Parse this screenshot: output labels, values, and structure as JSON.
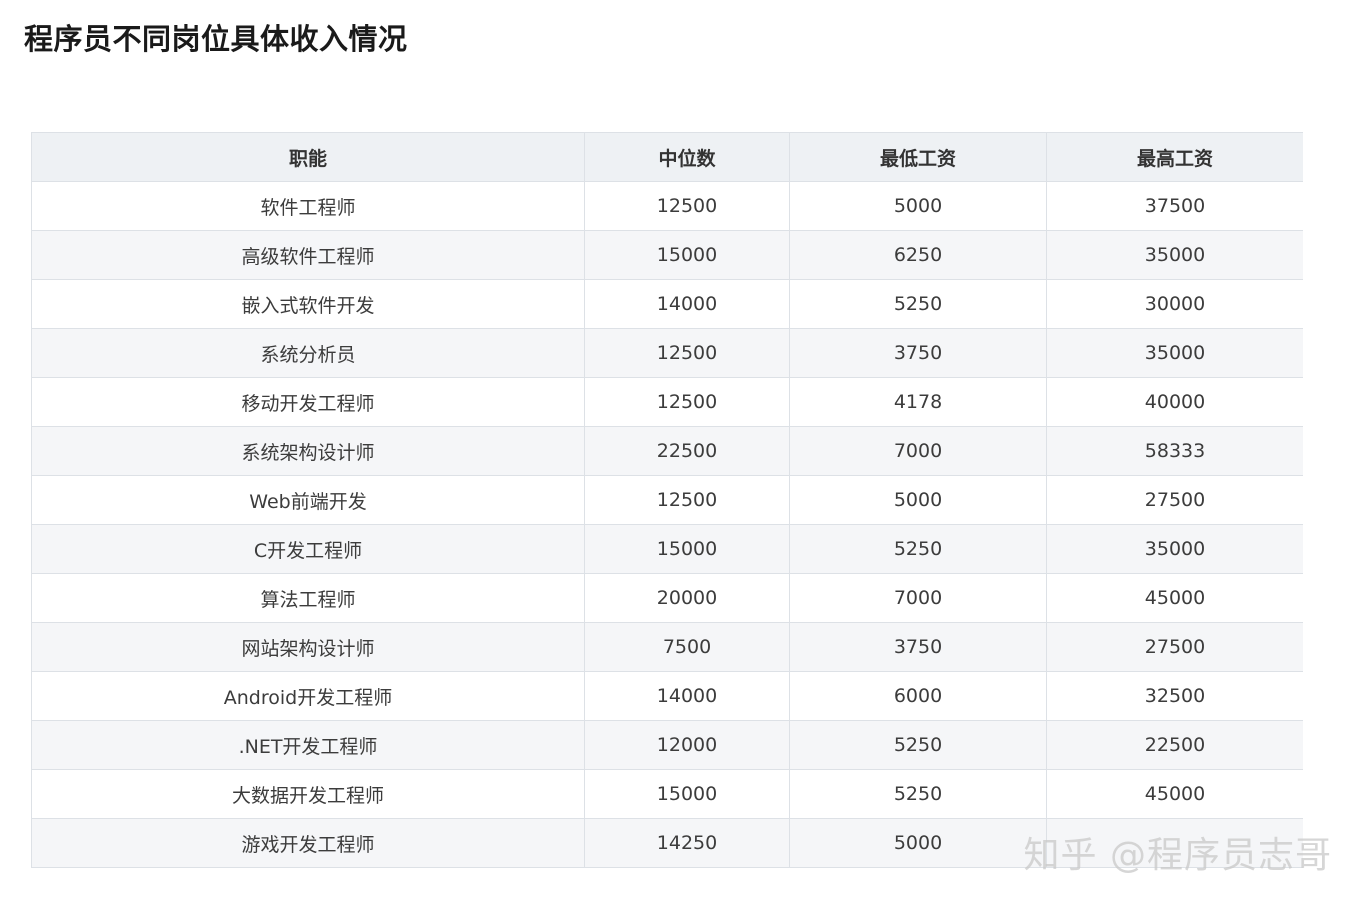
{
  "page": {
    "title": "程序员不同岗位具体收入情况"
  },
  "table": {
    "headers": [
      "职能",
      "中位数",
      "最低工资",
      "最高工资"
    ],
    "rows": [
      [
        "软件工程师",
        "12500",
        "5000",
        "37500"
      ],
      [
        "高级软件工程师",
        "15000",
        "6250",
        "35000"
      ],
      [
        "嵌入式软件开发",
        "14000",
        "5250",
        "30000"
      ],
      [
        "系统分析员",
        "12500",
        "3750",
        "35000"
      ],
      [
        "移动开发工程师",
        "12500",
        "4178",
        "40000"
      ],
      [
        "系统架构设计师",
        "22500",
        "7000",
        "58333"
      ],
      [
        "Web前端开发",
        "12500",
        "5000",
        "27500"
      ],
      [
        "C开发工程师",
        "15000",
        "5250",
        "35000"
      ],
      [
        "算法工程师",
        "20000",
        "7000",
        "45000"
      ],
      [
        "网站架构设计师",
        "7500",
        "3750",
        "27500"
      ],
      [
        "Android开发工程师",
        "14000",
        "6000",
        "32500"
      ],
      [
        ".NET开发工程师",
        "12000",
        "5250",
        "22500"
      ],
      [
        "大数据开发工程师",
        "15000",
        "5250",
        "45000"
      ],
      [
        "游戏开发工程师",
        "14250",
        "5000",
        ""
      ]
    ]
  },
  "watermark": {
    "text": "知乎 @程序员志哥"
  },
  "colors": {
    "header_bg": "#eef1f4",
    "stripe_bg": "#f5f6f8",
    "border": "#dde1e6",
    "text": "#3c3c3c"
  }
}
